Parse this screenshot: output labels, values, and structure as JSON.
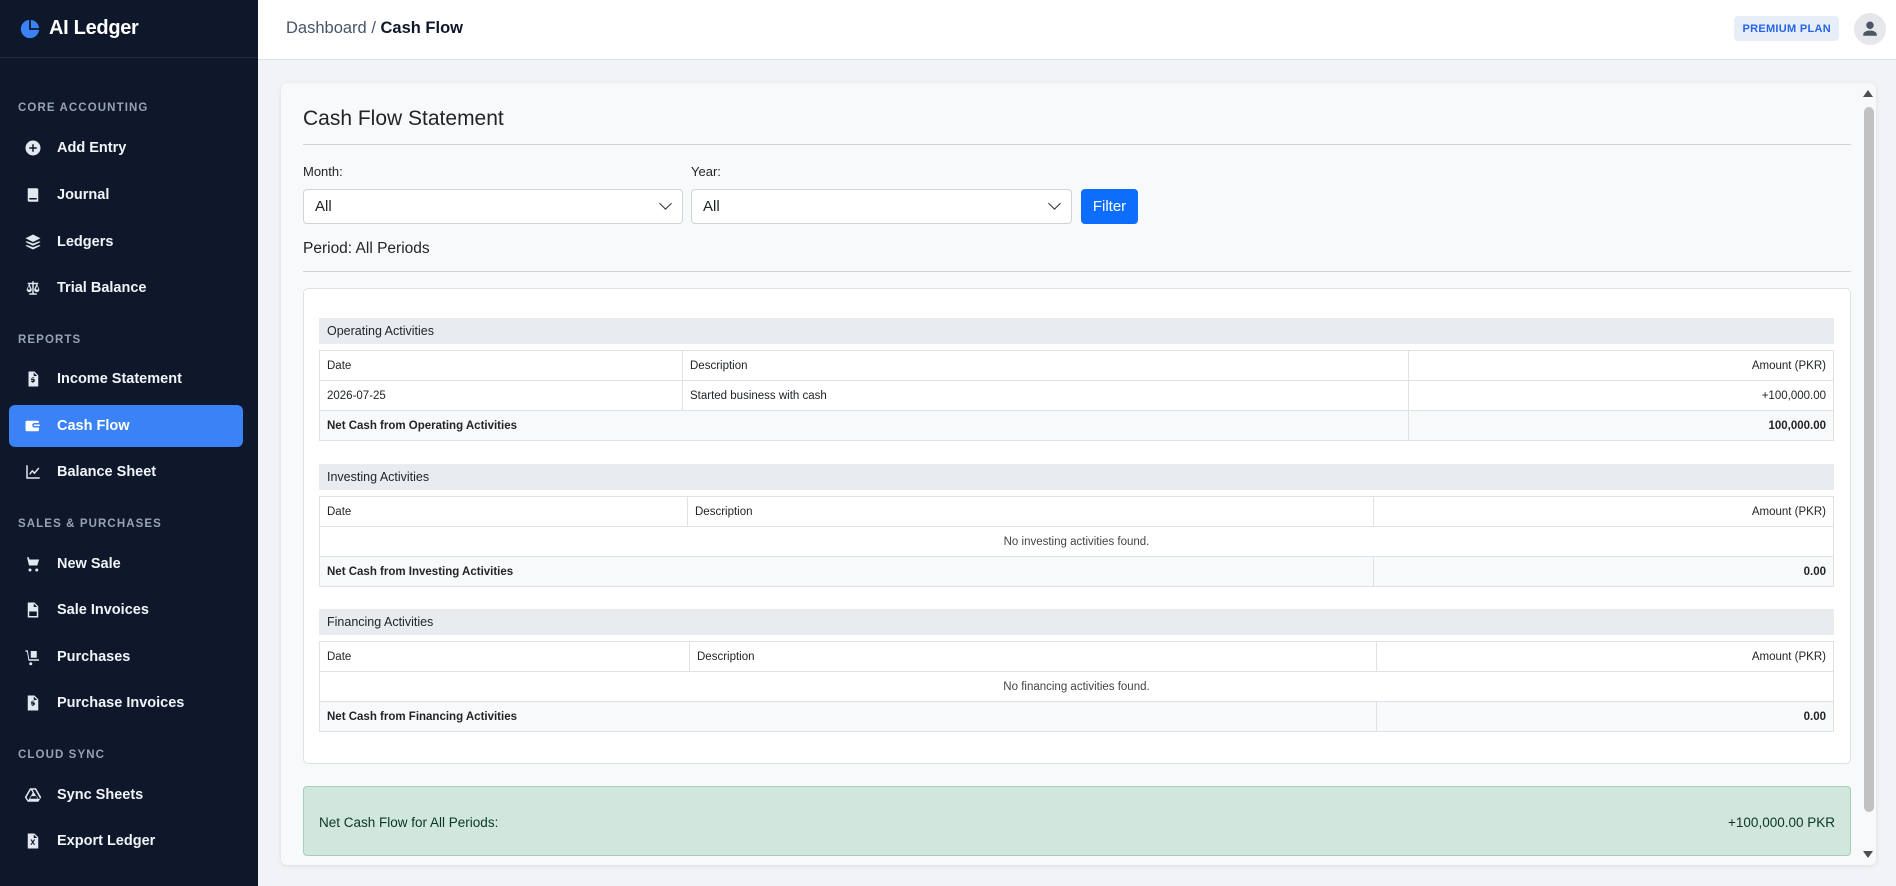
{
  "app": {
    "name": "AI Ledger"
  },
  "sidebar": {
    "sections": [
      {
        "title": "CORE ACCOUNTING"
      },
      {
        "title": "REPORTS"
      },
      {
        "title": "SALES & PURCHASES"
      },
      {
        "title": "CLOUD SYNC"
      }
    ],
    "items": [
      {
        "label": "Add Entry",
        "icon": "plus-circle-icon"
      },
      {
        "label": "Journal",
        "icon": "book-icon"
      },
      {
        "label": "Ledgers",
        "icon": "layers-icon"
      },
      {
        "label": "Trial Balance",
        "icon": "scale-icon"
      },
      {
        "label": "Income Statement",
        "icon": "invoice-icon"
      },
      {
        "label": "Cash Flow",
        "icon": "wallet-icon",
        "active": true
      },
      {
        "label": "Balance Sheet",
        "icon": "chart-icon"
      },
      {
        "label": "New Sale",
        "icon": "cart-icon"
      },
      {
        "label": "Sale Invoices",
        "icon": "file-pkr-icon"
      },
      {
        "label": "Purchases",
        "icon": "dolly-icon"
      },
      {
        "label": "Purchase Invoices",
        "icon": "file-dollar-icon"
      },
      {
        "label": "Sync Sheets",
        "icon": "drive-icon"
      },
      {
        "label": "Export Ledger",
        "icon": "file-excel-icon"
      }
    ]
  },
  "header": {
    "breadcrumb_root": "Dashboard",
    "breadcrumb_sep": " / ",
    "breadcrumb_current": "Cash Flow",
    "plan_badge": "PREMIUM PLAN"
  },
  "main": {
    "title": "Cash Flow Statement",
    "filters": {
      "month_label": "Month:",
      "month_value": "All",
      "year_label": "Year:",
      "year_value": "All",
      "filter_button": "Filter"
    },
    "period": "Period: All Periods",
    "columns": {
      "date": "Date",
      "description": "Description",
      "amount": "Amount (PKR)"
    },
    "operating": {
      "title": "Operating Activities",
      "rows": [
        {
          "date": "2026-07-25",
          "description": "Started business with cash",
          "amount": "+100,000.00"
        }
      ],
      "total_label": "Net Cash from Operating Activities",
      "total_value": "100,000.00"
    },
    "investing": {
      "title": "Investing Activities",
      "empty": "No investing activities found.",
      "total_label": "Net Cash from Investing Activities",
      "total_value": "0.00"
    },
    "financing": {
      "title": "Financing Activities",
      "empty": "No financing activities found.",
      "total_label": "Net Cash from Financing Activities",
      "total_value": "0.00"
    },
    "net": {
      "label": "Net Cash Flow for All Periods:",
      "value": "+100,000.00 PKR"
    }
  },
  "colors": {
    "sidebar_bg": "#0f172a",
    "accent": "#3b82f6",
    "primary_button": "#0d6efd",
    "success_bg": "#d1e7dd"
  }
}
